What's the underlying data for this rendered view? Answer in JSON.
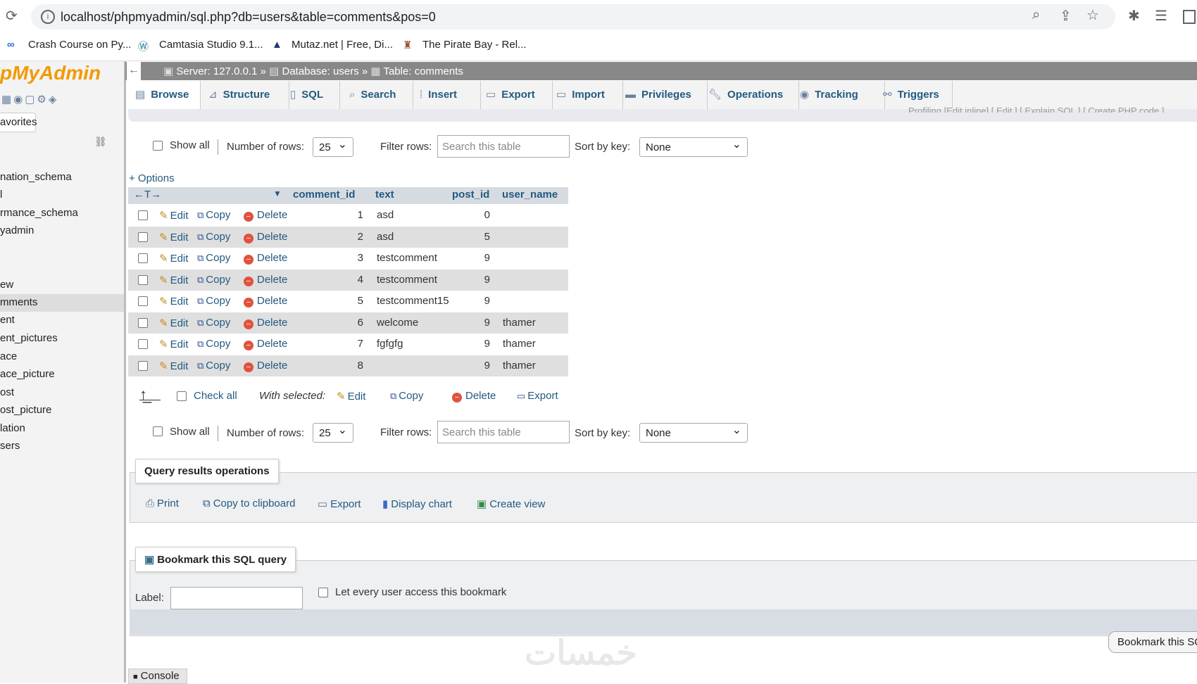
{
  "browser": {
    "url": "localhost/phpmyadmin/sql.php?db=users&table=comments&pos=0",
    "bookmarks": [
      "Crash Course on Py...",
      "Camtasia Studio 9.1...",
      "Mutaz.net | Free, Di...",
      "The Pirate Bay - Rel..."
    ]
  },
  "sidebar": {
    "logo": "pMyAdmin",
    "favorites": "avorites",
    "items": [
      "nation_schema",
      "l",
      "rmance_schema",
      "yadmin",
      "ew",
      "mments",
      "ent",
      "ent_pictures",
      "ace",
      "ace_picture",
      "ost",
      "ost_picture",
      "lation",
      "sers"
    ]
  },
  "breadcrumb": {
    "server": "Server: 127.0.0.1",
    "database": "Database: users",
    "table": "Table: comments",
    "sep": "»"
  },
  "tabs": [
    "Browse",
    "Structure",
    "SQL",
    "Search",
    "Insert",
    "Export",
    "Import",
    "Privileges",
    "Operations",
    "Tracking",
    "Triggers"
  ],
  "profiling": "Profiling [Edit inline] [ Edit ] [ Explain SQL ] [ Create PHP code ]",
  "nav": {
    "show_all": "Show all",
    "rows_label": "Number of rows:",
    "rows_value": "25",
    "filter_label": "Filter rows:",
    "filter_placeholder": "Search this table",
    "sort_label": "Sort by key:",
    "sort_value": "None"
  },
  "options_link": "+ Options",
  "columns": [
    "comment_id",
    "text",
    "post_id",
    "user_name"
  ],
  "actions": {
    "edit": "Edit",
    "copy": "Copy",
    "delete": "Delete"
  },
  "rows": [
    {
      "comment_id": "1",
      "text": "asd",
      "post_id": "0",
      "user_name": ""
    },
    {
      "comment_id": "2",
      "text": "asd",
      "post_id": "5",
      "user_name": ""
    },
    {
      "comment_id": "3",
      "text": "testcomment",
      "post_id": "9",
      "user_name": ""
    },
    {
      "comment_id": "4",
      "text": "testcomment",
      "post_id": "9",
      "user_name": ""
    },
    {
      "comment_id": "5",
      "text": "testcomment15",
      "post_id": "9",
      "user_name": ""
    },
    {
      "comment_id": "6",
      "text": "welcome",
      "post_id": "9",
      "user_name": "thamer"
    },
    {
      "comment_id": "7",
      "text": "fgfgfg",
      "post_id": "9",
      "user_name": "thamer"
    },
    {
      "comment_id": "8",
      "text": "",
      "post_id": "9",
      "user_name": "thamer"
    }
  ],
  "bulk": {
    "check_all": "Check all",
    "with_selected": "With selected:",
    "edit": "Edit",
    "copy": "Copy",
    "delete": "Delete",
    "export": "Export"
  },
  "query_ops": {
    "legend": "Query results operations",
    "print": "Print",
    "copy_clipboard": "Copy to clipboard",
    "export": "Export",
    "display_chart": "Display chart",
    "create_view": "Create view"
  },
  "bookmark": {
    "legend": "Bookmark this SQL query",
    "label": "Label:",
    "every_user": "Let every user access this bookmark",
    "button": "Bookmark this SQ"
  },
  "console": "Console",
  "watermark": "خمسات",
  "colors": {
    "link": "#235a81",
    "topbar": "#888888",
    "logo": "#f29a00"
  }
}
